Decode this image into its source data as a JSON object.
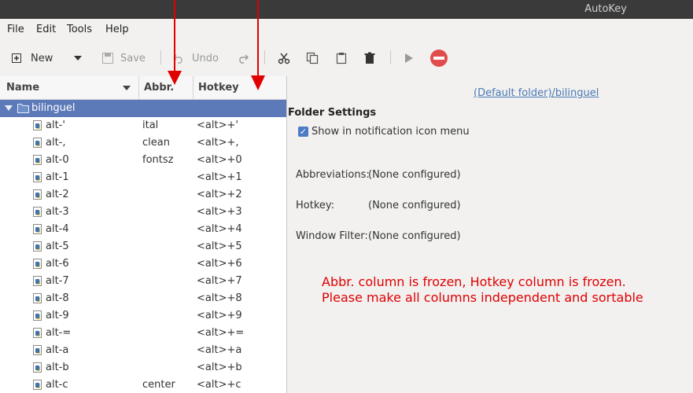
{
  "window": {
    "title": "AutoKey"
  },
  "menu": [
    "File",
    "Edit",
    "Tools",
    "Help"
  ],
  "toolbar": {
    "new_label": "New",
    "save_label": "Save",
    "undo_label": "Undo",
    "colors": {
      "stop": "#e24b4b",
      "accent": "#5d7ab8"
    }
  },
  "tree": {
    "columns": {
      "name": "Name",
      "abbr": "Abbr.",
      "hotkey": "Hotkey"
    },
    "folder": "bilinguel",
    "rows": [
      {
        "name": "alt-'",
        "abbr": "ital",
        "hotkey": "<alt>+'"
      },
      {
        "name": "alt-,",
        "abbr": "clean",
        "hotkey": "<alt>+,"
      },
      {
        "name": "alt-0",
        "abbr": "fontsz",
        "hotkey": "<alt>+0"
      },
      {
        "name": "alt-1",
        "abbr": "",
        "hotkey": "<alt>+1"
      },
      {
        "name": "alt-2",
        "abbr": "",
        "hotkey": "<alt>+2"
      },
      {
        "name": "alt-3",
        "abbr": "",
        "hotkey": "<alt>+3"
      },
      {
        "name": "alt-4",
        "abbr": "",
        "hotkey": "<alt>+4"
      },
      {
        "name": "alt-5",
        "abbr": "",
        "hotkey": "<alt>+5"
      },
      {
        "name": "alt-6",
        "abbr": "",
        "hotkey": "<alt>+6"
      },
      {
        "name": "alt-7",
        "abbr": "",
        "hotkey": "<alt>+7"
      },
      {
        "name": "alt-8",
        "abbr": "",
        "hotkey": "<alt>+8"
      },
      {
        "name": "alt-9",
        "abbr": "",
        "hotkey": "<alt>+9"
      },
      {
        "name": "alt-=",
        "abbr": "",
        "hotkey": "<alt>+="
      },
      {
        "name": "alt-a",
        "abbr": "",
        "hotkey": "<alt>+a"
      },
      {
        "name": "alt-b",
        "abbr": "",
        "hotkey": "<alt>+b"
      },
      {
        "name": "alt-c",
        "abbr": "center",
        "hotkey": "<alt>+c"
      }
    ]
  },
  "details": {
    "path_link": "(Default folder)/bilinguel",
    "section_title": "Folder Settings",
    "show_in_tray_label": "Show in notification icon menu",
    "show_in_tray_checked": true,
    "abbreviations_label": "Abbreviations:",
    "abbreviations_value": "(None configured)",
    "hotkey_label": "Hotkey:",
    "hotkey_value": "(None configured)",
    "window_filter_label": "Window Filter:",
    "window_filter_value": "(None configured)"
  },
  "annotation": {
    "line1": "Abbr. column is frozen, Hotkey column is frozen.",
    "line2": "Please make all columns independent and sortable",
    "color": "#e00000"
  }
}
